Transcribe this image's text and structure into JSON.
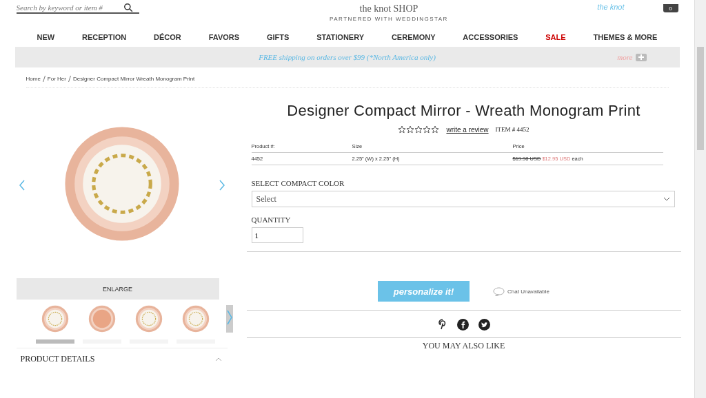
{
  "header": {
    "search_placeholder": "Search by keyword or item #",
    "logo": "the knot SHOP",
    "tagline": "PARTNERED WITH WEDDINGSTAR",
    "account_link": "the knot",
    "cart_count": "0"
  },
  "nav": [
    {
      "label": "NEW",
      "sale": false
    },
    {
      "label": "RECEPTION",
      "sale": false
    },
    {
      "label": "DÉCOR",
      "sale": false
    },
    {
      "label": "FAVORS",
      "sale": false
    },
    {
      "label": "GIFTS",
      "sale": false
    },
    {
      "label": "STATIONERY",
      "sale": false
    },
    {
      "label": "CEREMONY",
      "sale": false
    },
    {
      "label": "ACCESSORIES",
      "sale": false
    },
    {
      "label": "SALE",
      "sale": true
    },
    {
      "label": "THEMES & MORE",
      "sale": false
    }
  ],
  "promo": {
    "text": "FREE shipping on orders over $99 (*North America only)",
    "more": "more"
  },
  "breadcrumb": [
    "Home",
    "For Her",
    "Designer Compact Mirror Wreath Monogram Print"
  ],
  "gallery": {
    "enlarge": "ENLARGE",
    "thumbnails": [
      {
        "selected": true
      },
      {
        "selected": false
      },
      {
        "selected": false
      },
      {
        "selected": false
      }
    ]
  },
  "product_details": "PRODUCT DETAILS",
  "product": {
    "title": "Designer Compact Mirror - Wreath Monogram Print",
    "stars": 0,
    "review_link": "write a review",
    "item_number": "ITEM # 4452",
    "table": {
      "columns": [
        "Product #:",
        "Size",
        "Price"
      ],
      "rows": [
        {
          "product": "4452",
          "size": "2.25\" (W) x 2.25\" (H)",
          "old_price": "$19.98 USD",
          "price": "$12.95 USD",
          "unit": "each"
        }
      ]
    },
    "color_label": "SELECT COMPACT COLOR",
    "color_placeholder": "Select",
    "quantity_label": "QUANTITY",
    "quantity": "1",
    "personalize": "personalize it!",
    "chat": "Chat Unavailable"
  },
  "also_like": "YOU MAY ALSO LIKE"
}
